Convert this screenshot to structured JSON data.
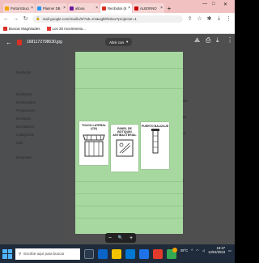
{
  "browser": {
    "tabs": [
      {
        "label": "Portal Educati",
        "color": "#f4a300"
      },
      {
        "label": "Planner DB P.",
        "color": "#2196f3"
      },
      {
        "label": "afiona",
        "color": "#6a1b9a"
      },
      {
        "label": "Recibidos (821)",
        "color": "#d93025"
      },
      {
        "label": "ALBORNO",
        "color": "#cc0000"
      }
    ],
    "new_tab": "+",
    "url": "mail.google.com/mail/u/0/?ab=rm&ogbl#inbox?projector=1",
    "bookmarks": [
      {
        "label": "Buscar Magnitudes",
        "color": "#d93025"
      },
      {
        "label": "Los 25 movimiento...",
        "color": "#e53935"
      }
    ]
  },
  "viewer": {
    "file_name": "1681172798630.jpg",
    "open_with": "Abrir con",
    "zoom_minus": "−",
    "zoom_icon": "🔍",
    "zoom_plus": "+"
  },
  "gmail_background": {
    "sidebar": [
      "Redactar",
      "Recibidos",
      "Destacados",
      "Pospuestos",
      "Enviados",
      "Borradores",
      "Categorías",
      "Más",
      "Etiquetas"
    ],
    "right": [
      "Compras online",
      "Las respuestas",
      "Estimado Paul",
      "Sin asignar",
      "Calificaciones"
    ]
  },
  "cards": [
    {
      "label": "TOLDO LATERAL (CN)",
      "icon": "awning-icon"
    },
    {
      "label": "PANEL DE BOTIQUIN ANTIBACTERIAL",
      "icon": "medical-sign-icon"
    },
    {
      "label": "PUERTO BALIZAJE",
      "icon": "post-icon"
    }
  ],
  "taskbar": {
    "search_placeholder": "Escribe aquí para buscar",
    "temperature": "29°C",
    "time": "18:47",
    "date": "13/04/2023"
  }
}
